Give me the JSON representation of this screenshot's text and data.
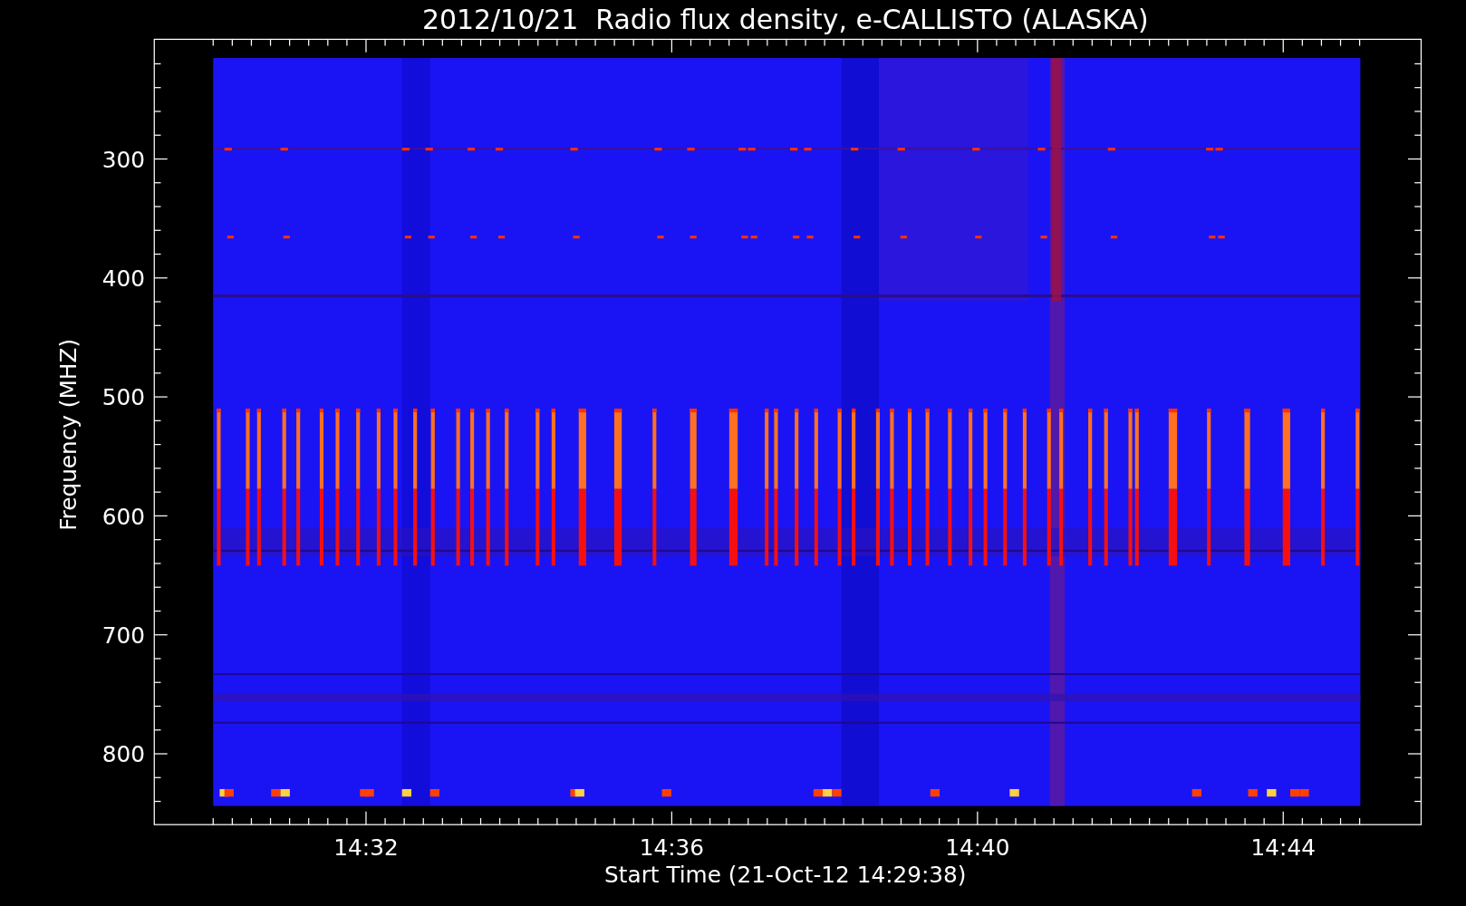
{
  "title": "2012/10/21  Radio flux density, e-CALLISTO (ALASKA)",
  "y_axis": {
    "label": "Frequency (MHZ)",
    "ticks": [
      "300",
      "400",
      "500",
      "600",
      "700",
      "800"
    ]
  },
  "x_axis": {
    "label": "Start Time (21-Oct-12 14:29:38)",
    "ticks": [
      "14:32",
      "14:36",
      "14:40",
      "14:44"
    ]
  }
}
